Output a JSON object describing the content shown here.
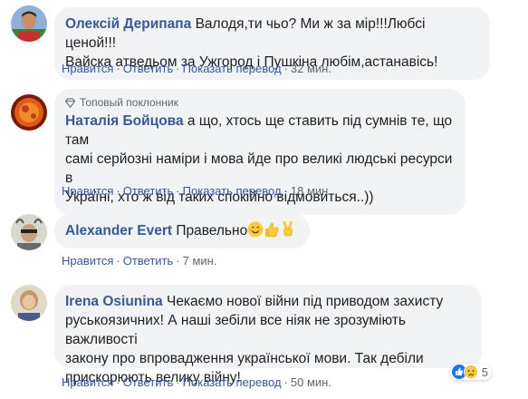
{
  "comments": [
    {
      "author": "Олексій Дерипапа",
      "line1_text": "Валодя,ти чьо? Ми ж за мір!!!Любсі ценой!!!",
      "line2": "Вайска атведьом за Ужгород і Пушкіна любім,астанавісь!",
      "like": "Нравится",
      "reply": "Ответить",
      "translate": "Показать перевод",
      "time": "32 мин."
    },
    {
      "badge": "Топовый поклонник",
      "author": "Наталія Бойцова",
      "line1_text": "а що, хтось ще ставить під сумнів те, що там",
      "line2": "самі серйозні наміри і мова йде про великі людські ресурси в",
      "line3": "Україні, хто ж від таких спокійно відмовиться..))",
      "like": "Нравится",
      "reply": "Ответить",
      "translate": "Показать перевод",
      "time": "18 мин."
    },
    {
      "author": "Alexander Evert",
      "text": "Правельно",
      "like": "Нравится",
      "reply": "Ответить",
      "time": "7 мин."
    },
    {
      "author": "Irena Osiunina",
      "line1_text": "Чекаємо нової війни під приводом захисту",
      "line2": "руськоязичних! А наші зебіли все ніяк не зрозуміють важливості",
      "line3": "закону про впровадження української мови. Так дебіли",
      "line4": "прискорюють велику війну!",
      "like": "Нравится",
      "reply": "Ответить",
      "translate": "Показать перевод",
      "time": "50 мин.",
      "reaction_count": "5"
    }
  ],
  "separator": "·"
}
